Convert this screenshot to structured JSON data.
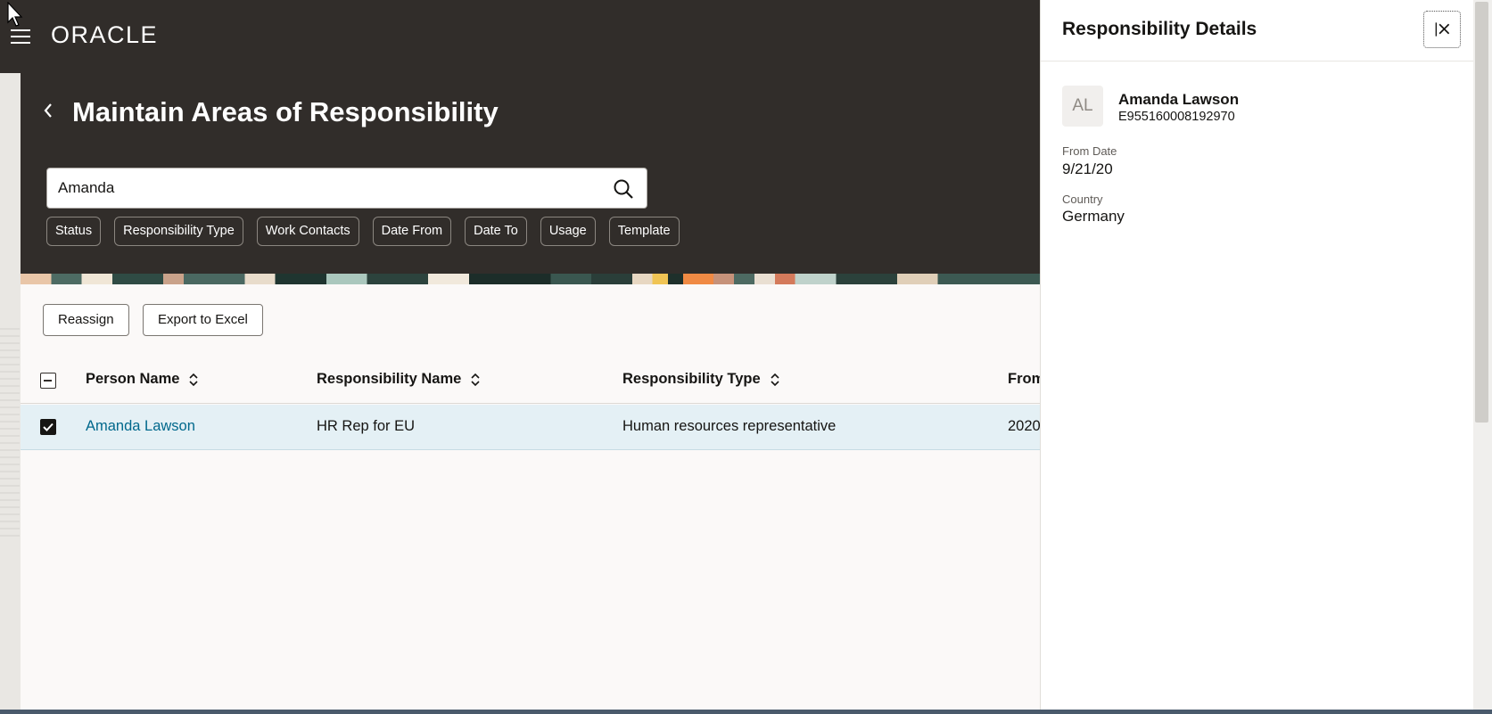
{
  "header": {
    "logo": "ORACLE",
    "page_title": "Maintain Areas of Responsibility"
  },
  "search": {
    "value": "Amanda"
  },
  "filters": [
    "Status",
    "Responsibility Type",
    "Work Contacts",
    "Date From",
    "Date To",
    "Usage",
    "Template"
  ],
  "toolbar": {
    "reassign_label": "Reassign",
    "export_label": "Export to Excel"
  },
  "table": {
    "columns": [
      "Person Name",
      "Responsibility Name",
      "Responsibility Type",
      "From"
    ],
    "rows": [
      {
        "person_name": "Amanda Lawson",
        "responsibility_name": "HR Rep for EU",
        "responsibility_type": "Human resources representative",
        "from": "2020",
        "selected": true
      }
    ]
  },
  "details": {
    "title": "Responsibility Details",
    "initials": "AL",
    "name": "Amanda Lawson",
    "person_number": "E955160008192970",
    "from_date_label": "From Date",
    "from_date": "9/21/20",
    "country_label": "Country",
    "country": "Germany"
  },
  "colors": {
    "header_bg": "#312d2a",
    "link": "#00688c",
    "selected_row": "#e4f0f5"
  }
}
